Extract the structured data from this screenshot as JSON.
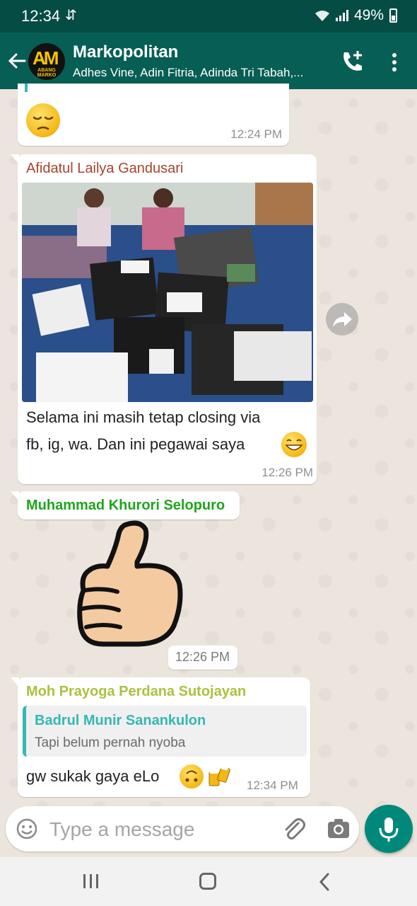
{
  "status_bar": {
    "time": "12:34",
    "battery": "49%"
  },
  "header": {
    "group_name": "Markopolitan",
    "members": "Adhes Vine, Adin Fitria, Adinda Tri Tabah,...",
    "avatar_text": "AM",
    "avatar_subtext": "ABANG MARKO"
  },
  "messages": [
    {
      "time": "12:24 PM",
      "emoji": "pensive-face"
    },
    {
      "sender": "Afidatul Lailya Gandusari",
      "sender_color": "#a5442c",
      "text_line1": "Selama ini masih tetap closing via",
      "text_line2": "fb,  ig,  wa. Dan ini pegawai saya",
      "time": "12:26 PM"
    },
    {
      "sender": "Muhammad Khurori Selopuro",
      "sender_color": "#1fa51c",
      "time": "12:26 PM",
      "sticker": "thumbs-up"
    },
    {
      "sender": "Moh Prayoga Perdana Sutojayan",
      "sender_color": "#a9c23f",
      "quote_author": "Badrul Munir Sanankulon",
      "quote_text": "Tapi belum pernah nyoba",
      "text": "gw sukak gaya eLo",
      "time": "12:34 PM"
    }
  ],
  "composer": {
    "placeholder": "Type a message"
  },
  "colors": {
    "header": "#075e54",
    "status_bar": "#054d44",
    "accent": "#00897b",
    "quote_bar": "#35b7b4"
  }
}
